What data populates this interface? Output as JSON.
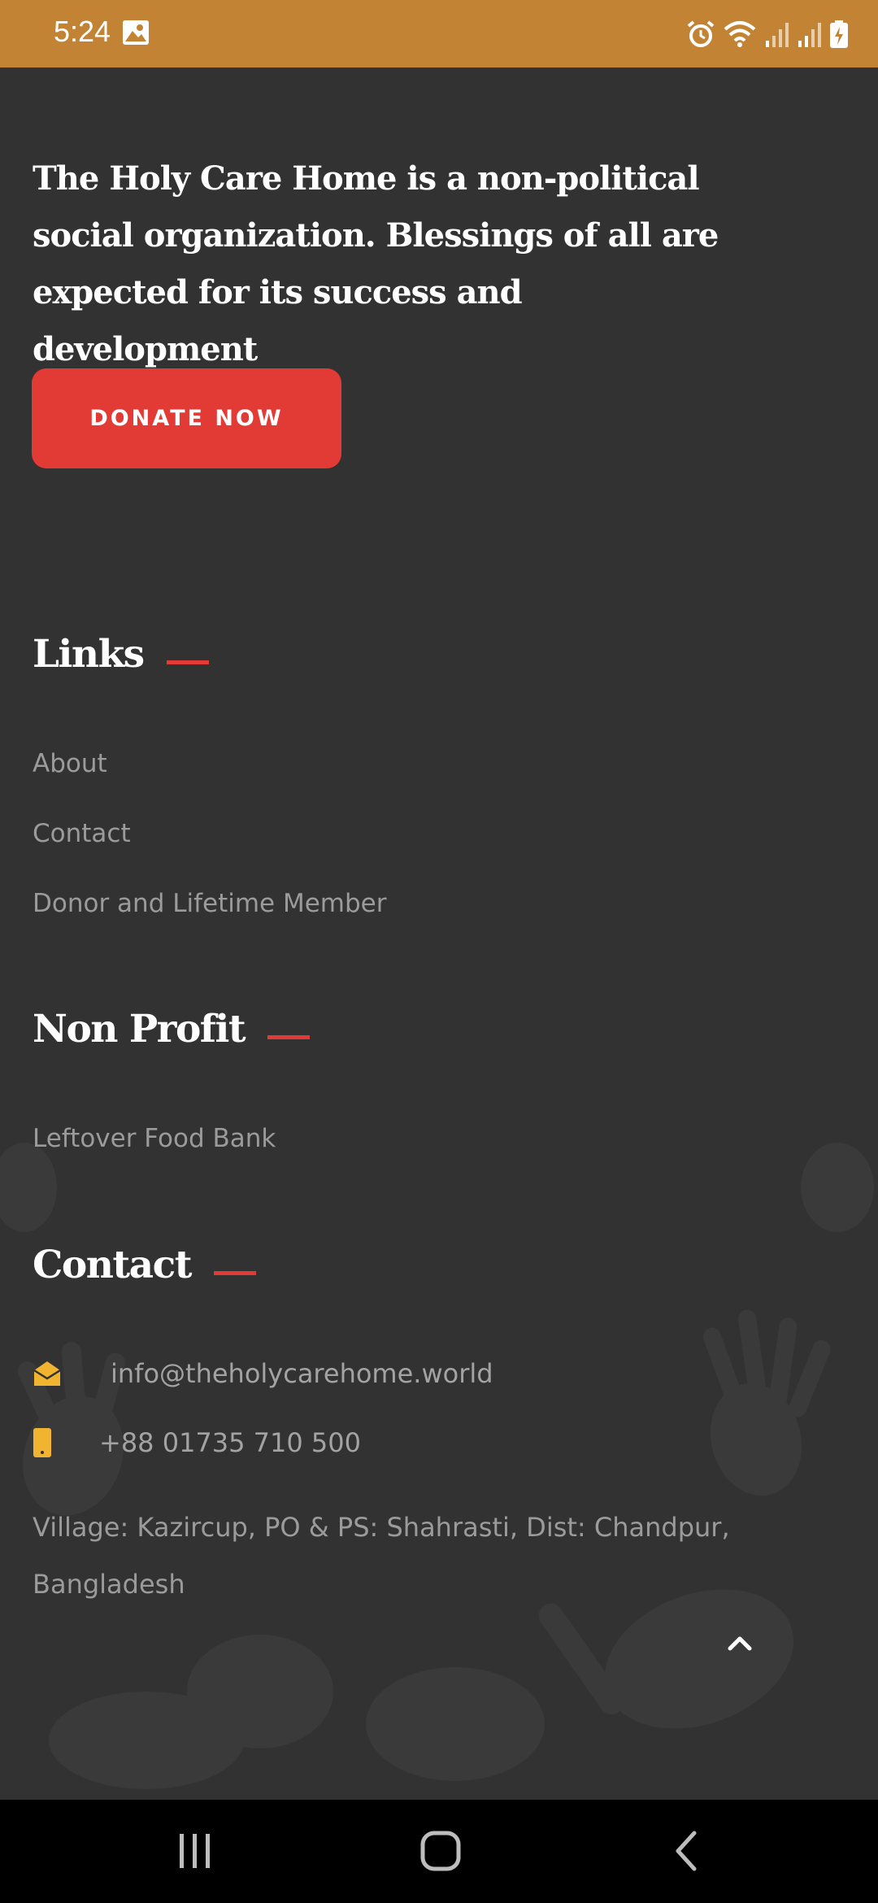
{
  "status_bar": {
    "time": "5:24",
    "icons": [
      "gallery-icon",
      "alarm-icon",
      "wifi-icon",
      "signal-icon",
      "signal-icon",
      "battery-icon"
    ],
    "background": "#c28434"
  },
  "footer": {
    "tagline": "The Holy Care Home is a non-political social organization. Blessings of all are expected for its success and development",
    "donate_label": "DONATE NOW",
    "links": {
      "title": "Links",
      "items": [
        "About",
        "Contact",
        "Donor and Lifetime Member"
      ]
    },
    "non_profit": {
      "title": "Non Profit",
      "items": [
        "Leftover Food Bank"
      ]
    },
    "contact": {
      "title": "Contact",
      "email": "info@theholycarehome.world",
      "phone": "+88 01735 710 500",
      "address": "Village: Kazircup, PO & PS: Shahrasti, Dist: Chandpur, Bangladesh"
    }
  },
  "colors": {
    "background": "#323232",
    "accent": "#e23b36",
    "icon": "#f0b430",
    "muted_text": "#9b9b9b"
  },
  "icons": {
    "email": "envelope-open-icon",
    "phone": "mobile-phone-icon",
    "scroll_top": "chevron-up-icon",
    "nav_recents": "recent-apps-icon",
    "nav_home": "home-icon",
    "nav_back": "back-icon"
  }
}
